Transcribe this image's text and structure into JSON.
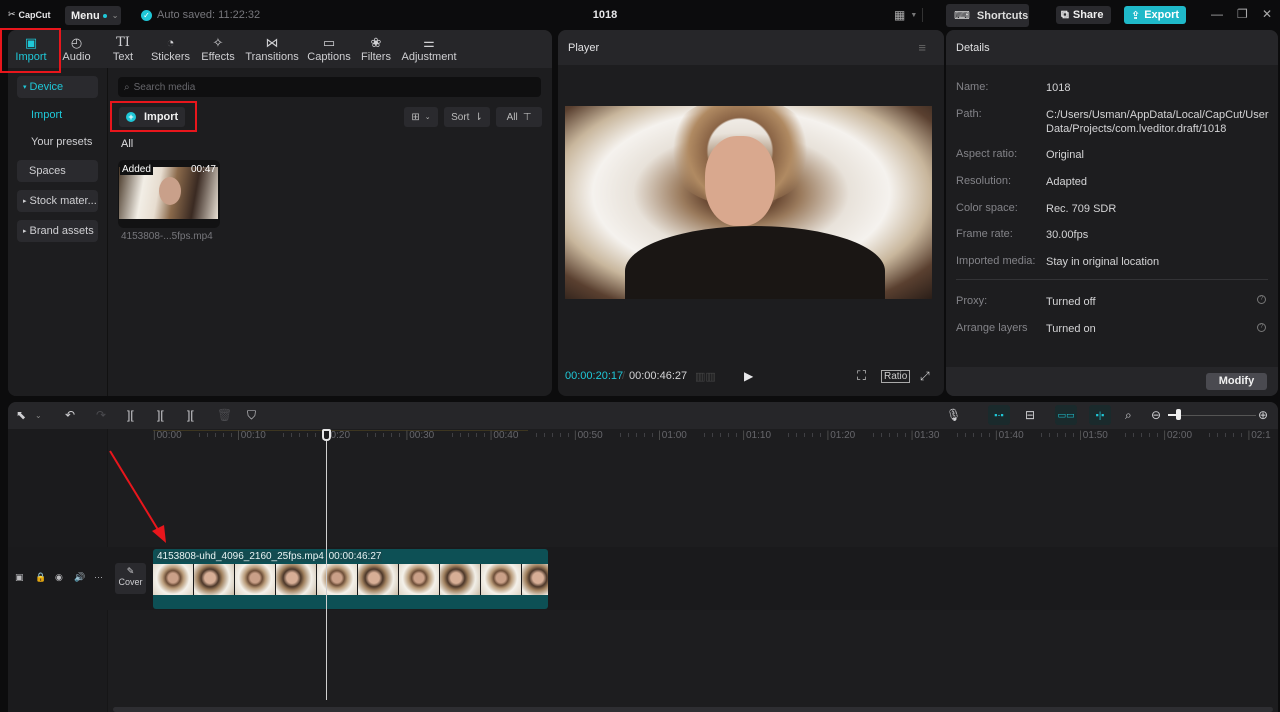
{
  "app": {
    "logo": "CapCut",
    "menu_label": "Menu",
    "autosave": "Auto saved: 11:22:32",
    "project_title": "1018",
    "shortcuts_label": "Shortcuts",
    "share_label": "Share",
    "export_label": "Export",
    "accent": "#1fc8d8",
    "highlight": "#e8161c"
  },
  "tabs": [
    {
      "label": "Import",
      "icon": "import-icon",
      "glyph": "▣",
      "active": true
    },
    {
      "label": "Audio",
      "icon": "audio-icon",
      "glyph": "◴"
    },
    {
      "label": "Text",
      "icon": "text-icon",
      "glyph": "TI"
    },
    {
      "label": "Stickers",
      "icon": "stickers-icon",
      "glyph": "◔"
    },
    {
      "label": "Effects",
      "icon": "effects-icon",
      "glyph": "✧"
    },
    {
      "label": "Transitions",
      "icon": "transitions-icon",
      "glyph": "⋈"
    },
    {
      "label": "Captions",
      "icon": "captions-icon",
      "glyph": "▭"
    },
    {
      "label": "Filters",
      "icon": "filters-icon",
      "glyph": "❀"
    },
    {
      "label": "Adjustment",
      "icon": "adjustment-icon",
      "glyph": "⚌"
    }
  ],
  "media_sidebar": {
    "device": "Device",
    "import": "Import",
    "presets": "Your presets",
    "spaces": "Spaces",
    "stock": "Stock mater...",
    "brand": "Brand assets"
  },
  "media": {
    "search_placeholder": "Search media",
    "import_button": "Import",
    "sort_label": "Sort",
    "filter_label": "All",
    "section_label": "All",
    "items": [
      {
        "badge": "Added",
        "duration": "00:47",
        "name": "4153808-...5fps.mp4"
      }
    ]
  },
  "player": {
    "title": "Player",
    "current_time": "00:00:20:17",
    "total_time": "00:00:46:27",
    "ratio_label": "Ratio"
  },
  "details": {
    "title": "Details",
    "rows": [
      {
        "label": "Name:",
        "value": "1018"
      },
      {
        "label": "Path:",
        "value": "C:/Users/Usman/AppData/Local/CapCut/User Data/Projects/com.lveditor.draft/1018"
      },
      {
        "label": "Aspect ratio:",
        "value": "Original"
      },
      {
        "label": "Resolution:",
        "value": "Adapted"
      },
      {
        "label": "Color space:",
        "value": "Rec. 709 SDR"
      },
      {
        "label": "Frame rate:",
        "value": "30.00fps"
      },
      {
        "label": "Imported media:",
        "value": "Stay in original location"
      }
    ],
    "settings": [
      {
        "label": "Proxy:",
        "value": "Turned off"
      },
      {
        "label": "Arrange layers",
        "value": "Turned on"
      }
    ],
    "modify_label": "Modify"
  },
  "timeline": {
    "ticks": [
      "00:00",
      "00:10",
      "00:20",
      "00:30",
      "00:40",
      "00:50",
      "01:00",
      "01:10",
      "01:20",
      "01:30",
      "01:40",
      "01:50",
      "02:00",
      "02:1"
    ],
    "cover_label": "Cover",
    "clip_name": "4153808-uhd_4096_2160_25fps.mp4",
    "clip_duration": "00:00:46:27",
    "zoom_level": 0.1
  }
}
